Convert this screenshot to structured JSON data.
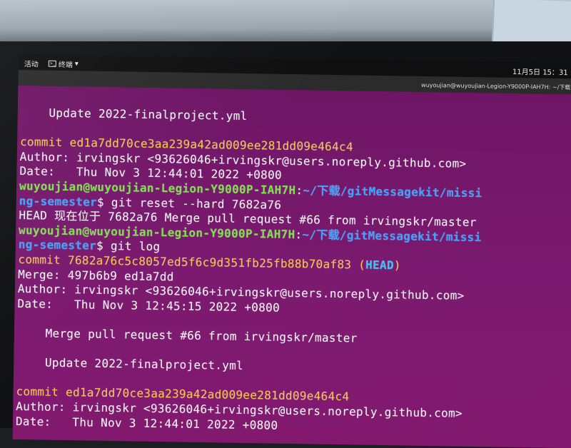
{
  "topbar": {
    "activities": "活动",
    "app_menu_label": "终端",
    "clock": "11月5日 15：31"
  },
  "window": {
    "title": "wuyoujian@wuyoujian-Legion-Y9000P-IAH7H: ~/下载"
  },
  "terminal": {
    "lines": [
      {
        "segments": [
          {
            "t": "    Update 2022-finalproject.yml",
            "c": "white"
          }
        ]
      },
      {
        "segments": [
          {
            "t": "",
            "c": "white"
          }
        ]
      },
      {
        "segments": [
          {
            "t": "commit ed1a7dd70ce3aa239a42ad009ee281dd09e464c4",
            "c": "yellow"
          }
        ]
      },
      {
        "segments": [
          {
            "t": "Author: irvingskr <93626046+irvingskr@users.noreply.github.com>",
            "c": "white"
          }
        ]
      },
      {
        "segments": [
          {
            "t": "Date:   Thu Nov 3 12:44:01 2022 +0800",
            "c": "white"
          }
        ]
      },
      {
        "segments": [
          {
            "t": "wuyoujian@wuyoujian-Legion-Y9000P-IAH7H",
            "c": "green"
          },
          {
            "t": ":",
            "c": "white"
          },
          {
            "t": "~/下载/gitMessagekit/missi",
            "c": "blue"
          }
        ]
      },
      {
        "segments": [
          {
            "t": "ng-semester",
            "c": "blue"
          },
          {
            "t": "$ git reset --hard 7682a76",
            "c": "white"
          }
        ]
      },
      {
        "segments": [
          {
            "t": "HEAD 现在位于 7682a76 Merge pull request #66 from irvingskr/master",
            "c": "white"
          }
        ]
      },
      {
        "segments": [
          {
            "t": "wuyoujian@wuyoujian-Legion-Y9000P-IAH7H",
            "c": "green"
          },
          {
            "t": ":",
            "c": "white"
          },
          {
            "t": "~/下载/gitMessagekit/missi",
            "c": "blue"
          }
        ]
      },
      {
        "segments": [
          {
            "t": "ng-semester",
            "c": "blue"
          },
          {
            "t": "$ git log",
            "c": "white"
          }
        ]
      },
      {
        "segments": [
          {
            "t": "commit 7682a76c5c8057ed5f6c9d351fb25fb88b70af83 (",
            "c": "yellow"
          },
          {
            "t": "HEAD",
            "c": "cyan"
          },
          {
            "t": ")",
            "c": "yellow"
          }
        ]
      },
      {
        "segments": [
          {
            "t": "Merge: 497b6b9 ed1a7dd",
            "c": "white"
          }
        ]
      },
      {
        "segments": [
          {
            "t": "Author: irvingskr <93626046+irvingskr@users.noreply.github.com>",
            "c": "white"
          }
        ]
      },
      {
        "segments": [
          {
            "t": "Date:   Thu Nov 3 12:45:15 2022 +0800",
            "c": "white"
          }
        ]
      },
      {
        "segments": [
          {
            "t": "",
            "c": "white"
          }
        ]
      },
      {
        "segments": [
          {
            "t": "    Merge pull request #66 from irvingskr/master",
            "c": "white"
          }
        ]
      },
      {
        "segments": [
          {
            "t": "",
            "c": "white"
          }
        ]
      },
      {
        "segments": [
          {
            "t": "    Update 2022-finalproject.yml",
            "c": "white"
          }
        ]
      },
      {
        "segments": [
          {
            "t": "",
            "c": "white"
          }
        ]
      },
      {
        "segments": [
          {
            "t": "commit ed1a7dd70ce3aa239a42ad009ee281dd09e464c4",
            "c": "yellow"
          }
        ]
      },
      {
        "segments": [
          {
            "t": "Author: irvingskr <93626046+irvingskr@users.noreply.github.com>",
            "c": "white"
          }
        ]
      },
      {
        "segments": [
          {
            "t": "Date:   Thu Nov 3 12:44:01 2022 +0800",
            "c": "white"
          }
        ]
      }
    ]
  },
  "colors": {
    "terminal_bg": "#7b1a70",
    "commit_yellow": "#f2c64a",
    "prompt_green": "#7ee04d",
    "path_blue": "#3da3ff",
    "head_cyan": "#39c5f5"
  }
}
